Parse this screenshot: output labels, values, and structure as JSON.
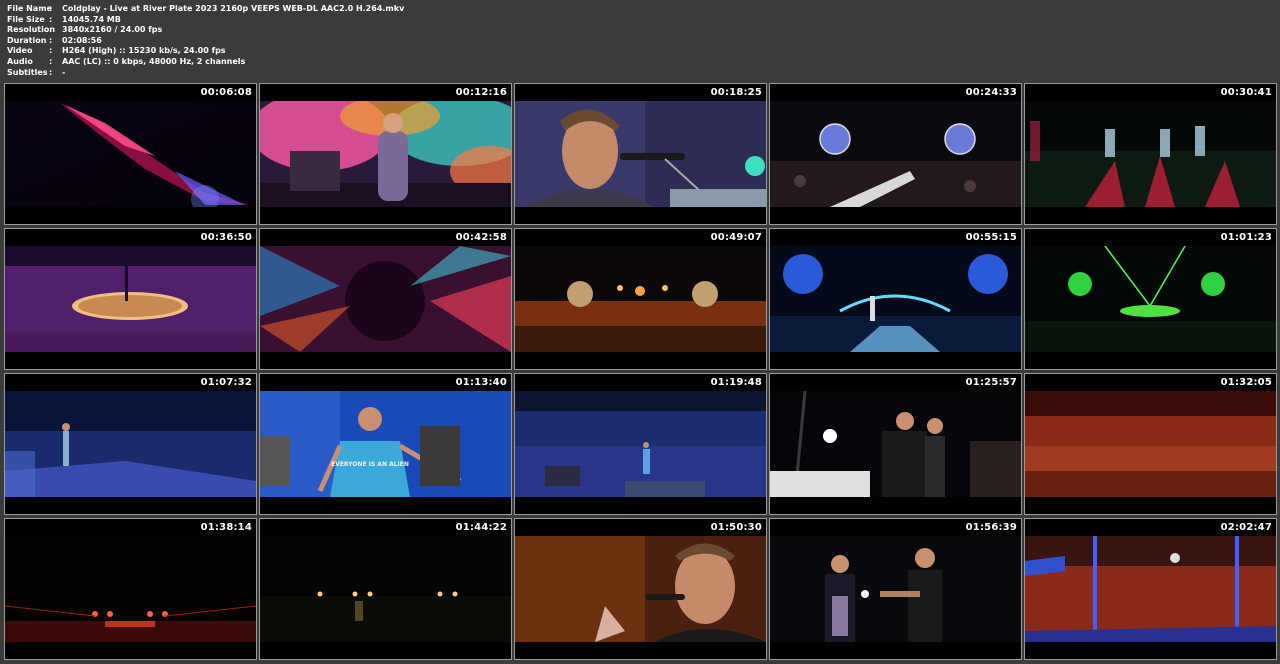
{
  "info": {
    "rows": [
      {
        "label": "File Name",
        "sep": ":",
        "value": "Coldplay - Live at River Plate 2023 2160p VEEPS WEB-DL AAC2.0 H.264.mkv"
      },
      {
        "label": "File Size",
        "sep": ":",
        "value": "14045.74 MB"
      },
      {
        "label": "Resolution",
        "sep": ":",
        "value": "3840x2160 / 24.00 fps"
      },
      {
        "label": "Duration",
        "sep": ":",
        "value": "02:08:56"
      },
      {
        "label": "Video",
        "sep": ":",
        "value": "H264 (High) :: 15230 kb/s, 24.00 fps"
      },
      {
        "label": "Audio",
        "sep": ":",
        "value": "AAC (LC) :: 0 kbps, 48000 Hz, 2 channels"
      },
      {
        "label": "Subtitles",
        "sep": ":",
        "value": "-"
      }
    ]
  },
  "thumbnails": [
    {
      "time": "00:06:08"
    },
    {
      "time": "00:12:16"
    },
    {
      "time": "00:18:25"
    },
    {
      "time": "00:24:33"
    },
    {
      "time": "00:30:41"
    },
    {
      "time": "00:36:50"
    },
    {
      "time": "00:42:58"
    },
    {
      "time": "00:49:07"
    },
    {
      "time": "00:55:15"
    },
    {
      "time": "01:01:23"
    },
    {
      "time": "01:07:32"
    },
    {
      "time": "01:13:40"
    },
    {
      "time": "01:19:48"
    },
    {
      "time": "01:25:57"
    },
    {
      "time": "01:32:05"
    },
    {
      "time": "01:38:14"
    },
    {
      "time": "01:44:22"
    },
    {
      "time": "01:50:30"
    },
    {
      "time": "01:56:39"
    },
    {
      "time": "02:02:47"
    }
  ],
  "scene_texts": {
    "shirt_text": "EVERYONE IS AN ALIEN"
  }
}
